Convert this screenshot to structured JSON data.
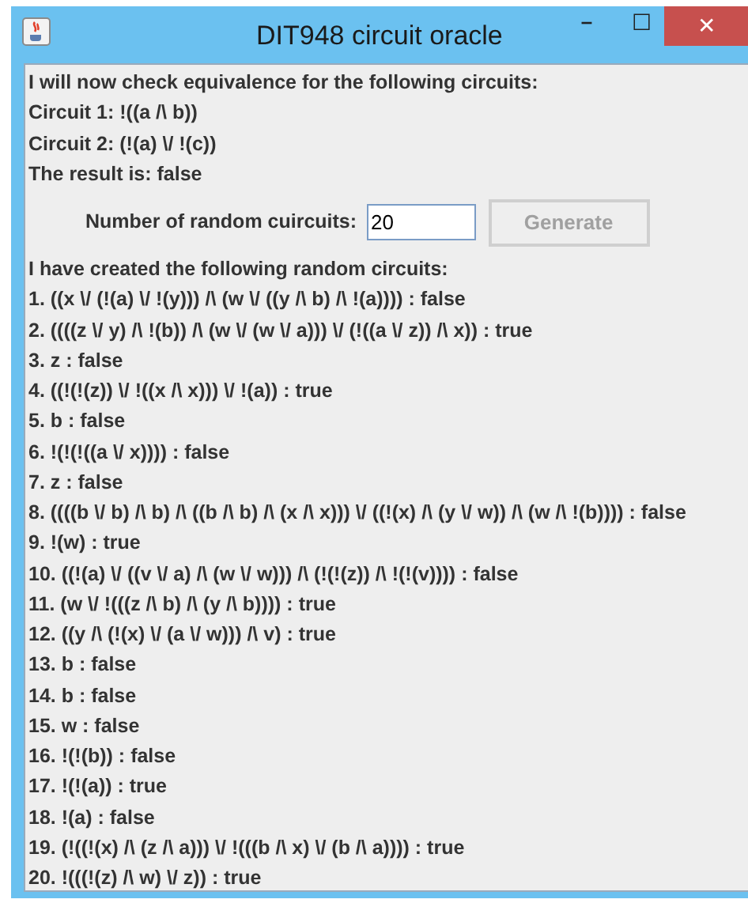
{
  "window": {
    "title": "DIT948 circuit oracle",
    "controls": [
      "–",
      "☐",
      "✕"
    ]
  },
  "intro_lines": [
    "I will now check equivalence for the following circuits:",
    "Circuit 1: !((a /\\ b))",
    "Circuit 2: (!(a) \\/ !(c))",
    "The result is: false"
  ],
  "random_form": {
    "label": "Number of random cuircuits:",
    "value": "20",
    "button": {
      "label": "Generate",
      "disabled": true
    }
  },
  "circuits_heading": "I have created the following random circuits:",
  "circuits": [
    "1. ((x \\/ (!(a) \\/ !(y))) /\\ (w \\/ ((y /\\ b) /\\ !(a)))) : false",
    "2. ((((z \\/ y) /\\ !(b)) /\\ (w \\/ (w \\/ a))) \\/ (!((a \\/ z)) /\\ x)) : true",
    "3. z : false",
    "4. ((!(!(z)) \\/ !((x /\\ x))) \\/ !(a)) : true",
    "5. b : false",
    "6. !(!(!((a \\/ x)))) : false",
    "7. z : false",
    "8. ((((b \\/ b) /\\ b) /\\ ((b /\\ b) /\\ (x /\\ x))) \\/ ((!(x) /\\ (y \\/ w)) /\\ (w /\\ !(b)))) : false",
    "9. !(w) : true",
    "10. ((!(a) \\/ ((v \\/ a) /\\ (w \\/ w))) /\\ (!(!(z)) /\\ !(!(v)))) : false",
    "11. (w \\/ !(((z /\\ b) /\\ (y /\\ b)))) : true",
    "12. ((y /\\ (!(x) \\/ (a \\/ w))) /\\ v) : true",
    "13. b : false",
    "14. b : false",
    "15. w : false",
    "16. !(!(b)) : false",
    "17. !(!(a)) : true",
    "18. !(a) : false",
    "19. (!((!(x) /\\ (z /\\ a))) \\/ !(((b /\\ x) \\/ (b /\\ a)))) : true",
    "20. !(((!(z) /\\ w) \\/ z)) : true"
  ]
}
